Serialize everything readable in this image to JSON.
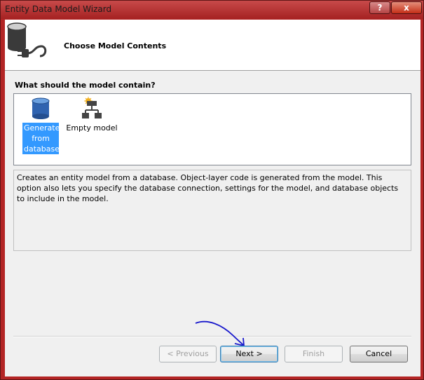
{
  "window": {
    "title": "Entity Data Model Wizard",
    "help_glyph": "?",
    "close_glyph": "x"
  },
  "header": {
    "title": "Choose Model Contents"
  },
  "section": {
    "label": "What should the model contain?"
  },
  "options": [
    {
      "label": "Generate from database",
      "icon": "database-icon",
      "selected": true
    },
    {
      "label": "Empty model",
      "icon": "hierarchy-icon",
      "selected": false
    }
  ],
  "description": "Creates an entity model from a database. Object-layer code is generated from the model. This option also lets you specify the database connection, settings for the model, and database objects to include in the model.",
  "buttons": {
    "previous": "< Previous",
    "next": "Next >",
    "finish": "Finish",
    "cancel": "Cancel"
  },
  "colors": {
    "frame": "#b32525",
    "selection": "#3399ff",
    "annotation": "#1a1acc"
  }
}
